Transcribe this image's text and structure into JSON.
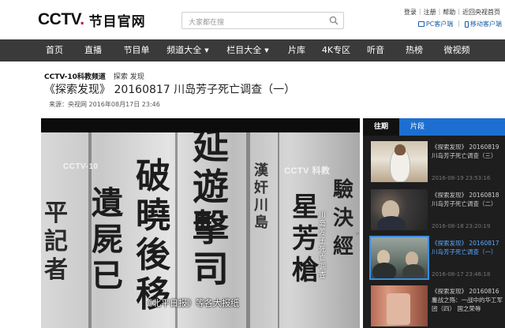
{
  "header": {
    "logo_mark_a": "CCTV",
    "logo_mark_b": ".",
    "logo_text": "节目官网",
    "search_placeholder": "大家都在搜",
    "top_links": [
      "登录",
      "注册",
      "帮助",
      "近回央视首页"
    ],
    "app_links": [
      "PC客户端",
      "移动客户端"
    ]
  },
  "nav": {
    "items": [
      {
        "label": "首页",
        "caret": false
      },
      {
        "label": "直播",
        "caret": false
      },
      {
        "label": "节目单",
        "caret": false
      },
      {
        "label": "频道大全",
        "caret": true
      },
      {
        "label": "栏目大全",
        "caret": true
      },
      {
        "label": "片库",
        "caret": false
      },
      {
        "label": "4K专区",
        "caret": false
      },
      {
        "label": "听音",
        "caret": false
      },
      {
        "label": "热榜",
        "caret": false
      },
      {
        "label": "微视频",
        "caret": false
      }
    ]
  },
  "program": {
    "channel": "CCTV-10科教频道",
    "tag": "探索 发现",
    "title": "《探索发现》 20160817 川岛芳子死亡调查（一）",
    "meta": "来源：央视网  2016年08月17日 23:46"
  },
  "player": {
    "watermark_left": "CCTV-10",
    "watermark_right": "CCTV 科教",
    "subtitle": "《北平日报》等各大报纸",
    "vertical_caption": "川岛芳子死亡调查",
    "collapse_glyph": "»"
  },
  "side": {
    "tabs": [
      "往期",
      "片段"
    ],
    "items": [
      {
        "title": "《探索发现》 20160819 川岛芳子死亡调查（三）",
        "date": "2016-08-19 23:53:16",
        "selected": false
      },
      {
        "title": "《探索发现》 20160818 川岛芳子死亡调查（二）",
        "date": "2016-08-18 23:20:19",
        "selected": false
      },
      {
        "title": "《探索发现》 20160817 川岛芳子死亡调查（一）",
        "date": "2016-08-17 23:46:18",
        "selected": true
      },
      {
        "title": "《探索发现》 20160816 鏖战之殇：一战中的华工军团（四） 国之荣辱",
        "date": "",
        "selected": false
      }
    ]
  },
  "colors": {
    "brand_red": "#c8102e",
    "nav_bg": "#3a3a3a",
    "accent_blue": "#1c6fd1",
    "selected_title": "#5aa7ff"
  }
}
